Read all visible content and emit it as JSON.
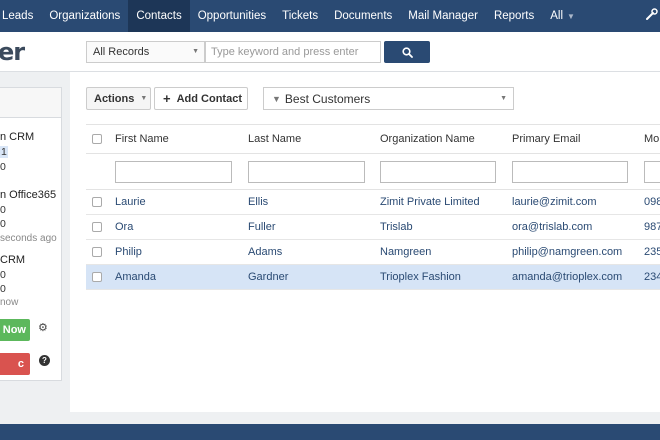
{
  "nav": {
    "items": [
      {
        "label": "Leads"
      },
      {
        "label": "Organizations"
      },
      {
        "label": "Contacts"
      },
      {
        "label": "Opportunities"
      },
      {
        "label": "Tickets"
      },
      {
        "label": "Documents"
      },
      {
        "label": "Mail Manager"
      },
      {
        "label": "Reports"
      },
      {
        "label": "All"
      }
    ],
    "active": "Contacts"
  },
  "logo_fragment": "er",
  "search": {
    "scope_value": "All Records",
    "placeholder": "Type keyword and press enter"
  },
  "sync_panel": {
    "crm_label": "n CRM",
    "crm_count1": "1",
    "crm_count2": "0",
    "office_label": "n Office365",
    "office_count1": "0",
    "office_count2": "0",
    "office_time": "seconds ago",
    "crm2_label": "CRM",
    "crm2_count1": "0",
    "crm2_count2": "0",
    "crm2_time": "now",
    "sync_button": "Now",
    "stop_button": "c"
  },
  "toolbar": {
    "actions_label": "Actions",
    "add_contact_label": "Add Contact",
    "filter_value": "Best Customers"
  },
  "table": {
    "columns": [
      "First Name",
      "Last Name",
      "Organization Name",
      "Primary Email",
      "Mo"
    ],
    "rows": [
      {
        "first": "Laurie",
        "last": "Ellis",
        "org": "Zimit Private Limited",
        "email": "laurie@zimit.com",
        "mobile": "098"
      },
      {
        "first": "Ora",
        "last": "Fuller",
        "org": "Trislab",
        "email": "ora@trislab.com",
        "mobile": "987"
      },
      {
        "first": "Philip",
        "last": "Adams",
        "org": "Namgreen",
        "email": "philip@namgreen.com",
        "mobile": "235"
      },
      {
        "first": "Amanda",
        "last": "Gardner",
        "org": "Trioplex Fashion",
        "email": "amanda@trioplex.com",
        "mobile": "234"
      }
    ],
    "selected_row": 3
  },
  "colors": {
    "nav_bg": "#2a4a73",
    "nav_active": "#1d3657",
    "selected_row": "#d6e4f6",
    "sync_green": "#5cb85c",
    "stop_red": "#d9534f"
  }
}
